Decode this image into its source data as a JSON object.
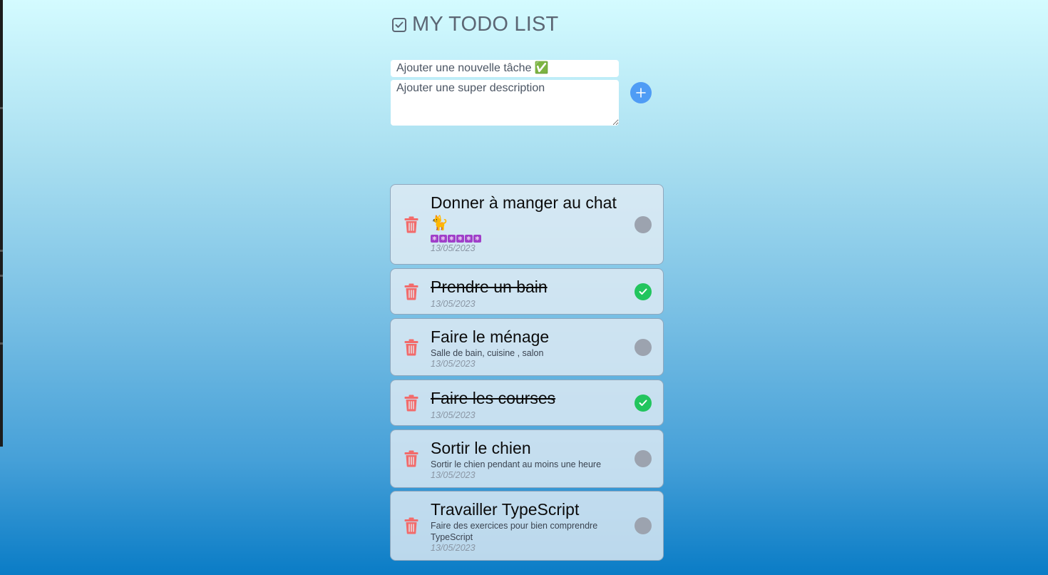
{
  "header": {
    "title": "MY TODO LIST",
    "icon": "checkbox-icon"
  },
  "form": {
    "task_placeholder": "Ajouter une nouvelle tâche ✅",
    "description_placeholder": "Ajouter une super description",
    "add_icon": "plus-icon"
  },
  "colors": {
    "accent": "#4f9cf5",
    "delete": "#f26b6b",
    "done": "#22c55e",
    "pending": "#9ca3af"
  },
  "todos": [
    {
      "title_line1": "Donner à manger au chat",
      "title_line2": "🐈",
      "badge": "❄❄❄❄❄❄",
      "description": "",
      "date": "13/05/2023",
      "completed": false
    },
    {
      "title": "Prendre un bain",
      "description": "",
      "date": "13/05/2023",
      "completed": true
    },
    {
      "title": "Faire le ménage",
      "description": "Salle de bain, cuisine , salon",
      "date": "13/05/2023",
      "completed": false
    },
    {
      "title": "Faire les courses",
      "description": "",
      "date": "13/05/2023",
      "completed": true
    },
    {
      "title": "Sortir le chien",
      "description": "Sortir le chien pendant au moins une heure",
      "date": "13/05/2023",
      "completed": false
    },
    {
      "title": "Travailler TypeScript",
      "description_line1": "Faire des exercices pour bien comprendre",
      "description_line2": "TypeScript",
      "date": "13/05/2023",
      "completed": false
    }
  ]
}
